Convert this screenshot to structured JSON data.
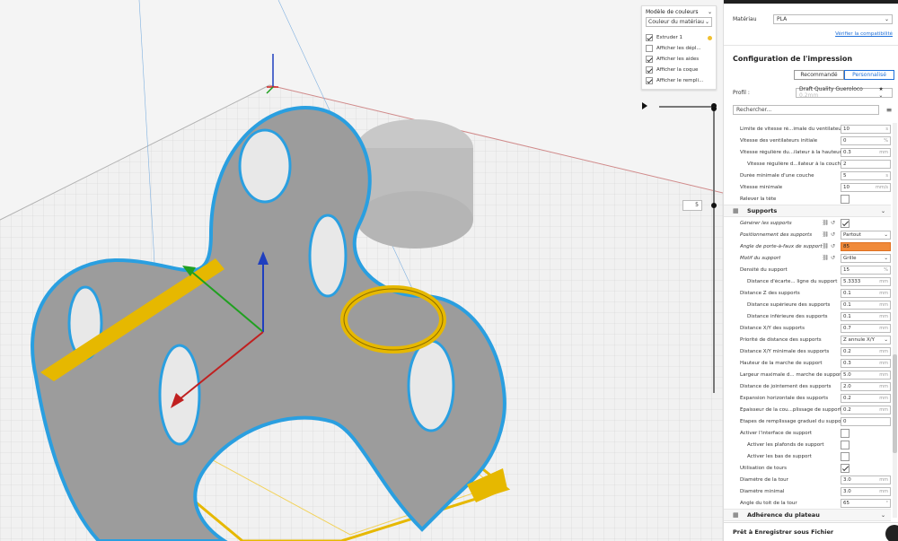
{
  "color_panel": {
    "title": "Modèle de couleurs",
    "scheme": "Couleur du matériau",
    "items": [
      {
        "label": "Extruder 1",
        "checked": true
      },
      {
        "label": "Afficher les dépl...",
        "checked": false
      },
      {
        "label": "Afficher les aides",
        "checked": true
      },
      {
        "label": "Afficher la coque",
        "checked": true
      },
      {
        "label": "Afficher le rempli...",
        "checked": true
      }
    ],
    "extruder_color": "#f0c030"
  },
  "layer": {
    "current": "5"
  },
  "material": {
    "label": "Matériau",
    "value": "PLA",
    "compat_link": "Vérifier la compatibilité"
  },
  "config": {
    "title": "Configuration de l'impression",
    "mode_recommended": "Recommandé",
    "mode_custom": "Personnalisé",
    "profile_label": "Profil :",
    "profile_value": "Draft Quality Gueroloco",
    "profile_suffix": "0.2mm",
    "search_placeholder": "Rechercher..."
  },
  "settings": [
    {
      "type": "row",
      "label": "Limite de vitesse ré...imale du ventilateur",
      "value": "10",
      "unit": "s"
    },
    {
      "type": "row",
      "label": "Vitesse des ventilateurs initiale",
      "value": "0",
      "unit": "%"
    },
    {
      "type": "row",
      "label": "Vitesse régulière du...ilateur à la hauteur",
      "value": "0.3",
      "unit": "mm"
    },
    {
      "type": "row",
      "indent": true,
      "label": "Vitesse régulière d...ilateur à la couche",
      "value": "2",
      "unit": ""
    },
    {
      "type": "row",
      "label": "Durée minimale d'une couche",
      "value": "5",
      "unit": "s"
    },
    {
      "type": "row",
      "label": "Vitesse minimale",
      "value": "10",
      "unit": "mm/s"
    },
    {
      "type": "check",
      "label": "Relever la tête",
      "checked": false
    },
    {
      "type": "section",
      "label": "Supports"
    },
    {
      "type": "check",
      "italic": true,
      "icons": true,
      "label": "Générer les supports",
      "checked": true
    },
    {
      "type": "select",
      "italic": true,
      "icons": true,
      "label": "Positionnement des supports",
      "value": "Partout"
    },
    {
      "type": "row",
      "italic": true,
      "icons": true,
      "warn": true,
      "label": "Angle de porte-à-faux de support",
      "value": "85",
      "unit": ""
    },
    {
      "type": "select",
      "italic": true,
      "icons": true,
      "label": "Motif du support",
      "value": "Grille"
    },
    {
      "type": "row",
      "label": "Densité du support",
      "value": "15",
      "unit": "%"
    },
    {
      "type": "row",
      "indent": true,
      "label": "Distance d'écarte... ligne du support",
      "value": "5.3333",
      "unit": "mm"
    },
    {
      "type": "row",
      "label": "Distance Z des supports",
      "value": "0.1",
      "unit": "mm"
    },
    {
      "type": "row",
      "indent": true,
      "label": "Distance supérieure des supports",
      "value": "0.1",
      "unit": "mm"
    },
    {
      "type": "row",
      "indent": true,
      "label": "Distance inférieure des supports",
      "value": "0.1",
      "unit": "mm"
    },
    {
      "type": "row",
      "label": "Distance X/Y des supports",
      "value": "0.7",
      "unit": "mm"
    },
    {
      "type": "select",
      "label": "Priorité de distance des supports",
      "value": "Z annule X/Y"
    },
    {
      "type": "row",
      "label": "Distance X/Y minimale des supports",
      "value": "0.2",
      "unit": "mm"
    },
    {
      "type": "row",
      "label": "Hauteur de la marche de support",
      "value": "0.3",
      "unit": "mm"
    },
    {
      "type": "row",
      "label": "Largeur maximale d... marche de support",
      "value": "5.0",
      "unit": "mm"
    },
    {
      "type": "row",
      "label": "Distance de jointement des supports",
      "value": "2.0",
      "unit": "mm"
    },
    {
      "type": "row",
      "label": "Expansion horizontale des supports",
      "value": "0.2",
      "unit": "mm"
    },
    {
      "type": "row",
      "label": "Épaisseur de la cou...plissage de support",
      "value": "0.2",
      "unit": "mm"
    },
    {
      "type": "row",
      "label": "Étapes de remplissage graduel du support",
      "value": "0",
      "unit": ""
    },
    {
      "type": "check",
      "label": "Activer l'interface de support",
      "checked": false
    },
    {
      "type": "check",
      "indent": true,
      "label": "Activer les plafonds de support",
      "checked": false
    },
    {
      "type": "check",
      "indent": true,
      "label": "Activer les bas de support",
      "checked": false
    },
    {
      "type": "check",
      "label": "Utilisation de tours",
      "checked": true
    },
    {
      "type": "row",
      "label": "Diamètre de la tour",
      "value": "3.0",
      "unit": "mm"
    },
    {
      "type": "row",
      "label": "Diamètre minimal",
      "value": "3.0",
      "unit": "mm"
    },
    {
      "type": "row",
      "label": "Angle du toit de la tour",
      "value": "65",
      "unit": "°"
    },
    {
      "type": "section",
      "label": "Adhérence du plateau"
    }
  ],
  "footer": {
    "status": "Prêt à Enregistrer sous Fichier"
  }
}
